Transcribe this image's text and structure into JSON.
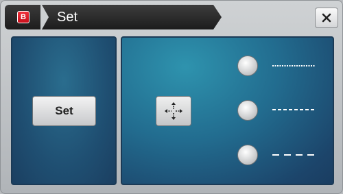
{
  "window": {
    "logo_letter": "B",
    "title": "Set",
    "close_symbol": "✕"
  },
  "left_panel": {
    "set_button_label": "Set"
  },
  "right_panel": {
    "move_icon": "move-crosshair-icon",
    "line_options": [
      {
        "style": "dotted"
      },
      {
        "style": "dashed-short"
      },
      {
        "style": "dashed-long"
      }
    ]
  },
  "colors": {
    "brand_red": "#e0202b",
    "panel_blue": "#226c8f"
  }
}
